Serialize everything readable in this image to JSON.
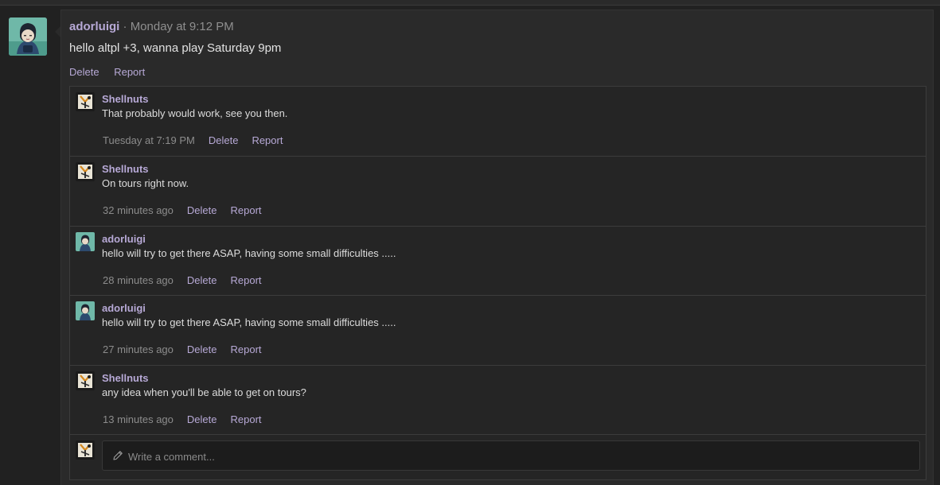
{
  "post": {
    "author": "adorluigi",
    "separator": " · ",
    "timestamp": "Monday at 9:12 PM",
    "body": "hello altpl +3, wanna play Saturday 9pm",
    "actions": {
      "delete": "Delete",
      "report": "Report"
    }
  },
  "comments": [
    {
      "author": "Shellnuts",
      "avatar": "shellnuts-avatar",
      "text": "That probably would work, see you then.",
      "time": "Tuesday at 7:19 PM",
      "delete": "Delete",
      "report": "Report"
    },
    {
      "author": "Shellnuts",
      "avatar": "shellnuts-avatar",
      "text": "On tours right now.",
      "time": "32 minutes ago",
      "delete": "Delete",
      "report": "Report"
    },
    {
      "author": "adorluigi",
      "avatar": "adorluigi-avatar",
      "text": "hello will try to get there ASAP, having some small difficulties .....",
      "time": "28 minutes ago",
      "delete": "Delete",
      "report": "Report"
    },
    {
      "author": "adorluigi",
      "avatar": "adorluigi-avatar",
      "text": "hello will try to get there ASAP, having some small difficulties .....",
      "time": "27 minutes ago",
      "delete": "Delete",
      "report": "Report"
    },
    {
      "author": "Shellnuts",
      "avatar": "shellnuts-avatar",
      "text": "any idea when you'll be able to get on tours?",
      "time": "13 minutes ago",
      "delete": "Delete",
      "report": "Report"
    }
  ],
  "comment_form": {
    "placeholder": "Write a comment...",
    "icon": "pencil-icon"
  },
  "colors": {
    "background": "#212121",
    "panel": "#2a2a2a",
    "link": "#b7a9d6",
    "text": "#e2e2e2",
    "muted": "#8c8c8c"
  }
}
